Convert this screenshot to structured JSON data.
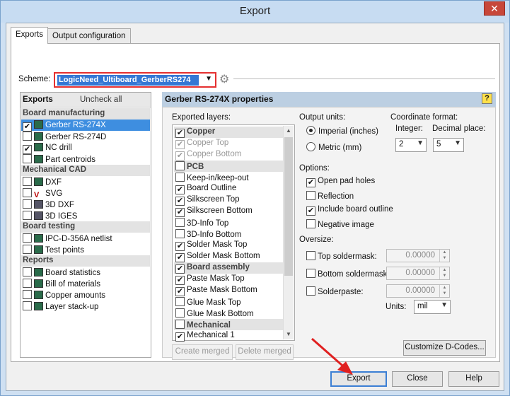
{
  "window": {
    "title": "Export",
    "close": "✕"
  },
  "tabs": [
    "Exports",
    "Output configuration"
  ],
  "scheme": {
    "label": "Scheme:",
    "value": "LogicNeed_Ultiboard_GerberRS274"
  },
  "left": {
    "header": "Exports",
    "uncheck_all": "Uncheck all",
    "sections": [
      {
        "title": "Board manufacturing",
        "items": [
          {
            "label": "Gerber RS-274X",
            "checked": "✔",
            "selected": true
          },
          {
            "label": "Gerber RS-274D",
            "checked": ""
          },
          {
            "label": "NC drill",
            "checked": "✔"
          },
          {
            "label": "Part centroids",
            "checked": ""
          }
        ]
      },
      {
        "title": "Mechanical CAD",
        "items": [
          {
            "label": "DXF",
            "checked": ""
          },
          {
            "label": "SVG",
            "checked": ""
          },
          {
            "label": "3D DXF",
            "checked": ""
          },
          {
            "label": "3D IGES",
            "checked": ""
          }
        ]
      },
      {
        "title": "Board testing",
        "items": [
          {
            "label": "IPC-D-356A netlist",
            "checked": ""
          },
          {
            "label": "Test points",
            "checked": ""
          }
        ]
      },
      {
        "title": "Reports",
        "items": [
          {
            "label": "Board statistics",
            "checked": ""
          },
          {
            "label": "Bill of materials",
            "checked": ""
          },
          {
            "label": "Copper amounts",
            "checked": ""
          },
          {
            "label": "Layer stack-up",
            "checked": ""
          }
        ]
      }
    ]
  },
  "props": {
    "title": "Gerber RS-274X properties",
    "help": "?",
    "exported_layers_label": "Exported layers:",
    "layers": [
      {
        "label": "Copper",
        "checked": "✔",
        "header": true
      },
      {
        "label": "Copper Top",
        "checked": "✔",
        "disabled": true
      },
      {
        "label": "Copper Bottom",
        "checked": "✔",
        "disabled": true
      },
      {
        "label": "PCB",
        "checked": "",
        "header": true
      },
      {
        "label": "Keep-in/keep-out",
        "checked": ""
      },
      {
        "label": "Board Outline",
        "checked": "✔"
      },
      {
        "label": "Silkscreen Top",
        "checked": "✔"
      },
      {
        "label": "Silkscreen Bottom",
        "checked": "✔"
      },
      {
        "label": "3D-Info Top",
        "checked": ""
      },
      {
        "label": "3D-Info Bottom",
        "checked": ""
      },
      {
        "label": "Solder Mask Top",
        "checked": "✔"
      },
      {
        "label": "Solder Mask Bottom",
        "checked": "✔"
      },
      {
        "label": "Board assembly",
        "checked": "✔",
        "header": true
      },
      {
        "label": "Paste Mask Top",
        "checked": "✔"
      },
      {
        "label": "Paste Mask Bottom",
        "checked": "✔"
      },
      {
        "label": "Glue Mask Top",
        "checked": ""
      },
      {
        "label": "Glue Mask Bottom",
        "checked": ""
      },
      {
        "label": "Mechanical",
        "checked": "",
        "header": true
      },
      {
        "label": "Mechanical 1",
        "checked": "✔"
      }
    ],
    "create_merged": "Create merged",
    "delete_merged": "Delete merged",
    "output_units_label": "Output units:",
    "imperial": "Imperial (inches)",
    "metric": "Metric (mm)",
    "coord_label": "Coordinate format:",
    "integer_label": "Integer:",
    "integer_value": "2",
    "decimal_label": "Decimal place:",
    "decimal_value": "5",
    "options_label": "Options:",
    "options": [
      {
        "label": "Open pad holes",
        "checked": "✔"
      },
      {
        "label": "Reflection",
        "checked": ""
      },
      {
        "label": "Include board outline",
        "checked": "✔"
      },
      {
        "label": "Negative image",
        "checked": ""
      }
    ],
    "oversize_label": "Oversize:",
    "oversize": [
      {
        "label": "Top soldermask:",
        "value": "0.00000"
      },
      {
        "label": "Bottom soldermask:",
        "value": "0.00000"
      },
      {
        "label": "Solderpaste:",
        "value": "0.00000"
      }
    ],
    "units_label": "Units:",
    "units_value": "mil",
    "customize": "Customize D-Codes..."
  },
  "buttons": {
    "export": "Export",
    "close": "Close",
    "help": "Help"
  },
  "colors": {
    "accent": "#3e8ee0",
    "highlight_border": "#e53030"
  }
}
